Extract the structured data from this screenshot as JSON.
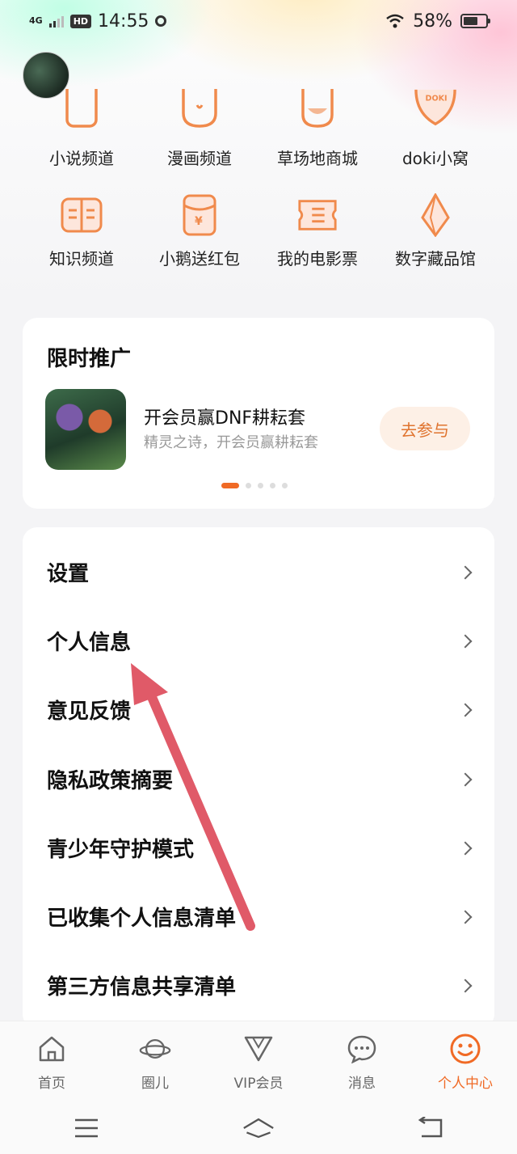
{
  "status": {
    "network": "4G",
    "hd": "HD",
    "time": "14:55",
    "battery": "58%"
  },
  "shortcuts": {
    "row1": [
      {
        "label": "小说频道",
        "icon": "book-icon"
      },
      {
        "label": "漫画频道",
        "icon": "comic-icon"
      },
      {
        "label": "草场地商城",
        "icon": "shop-icon"
      },
      {
        "label": "doki小窝",
        "icon": "doki-icon"
      }
    ],
    "row2": [
      {
        "label": "知识频道",
        "icon": "knowledge-icon"
      },
      {
        "label": "小鹅送红包",
        "icon": "red-packet-icon"
      },
      {
        "label": "我的电影票",
        "icon": "ticket-icon"
      },
      {
        "label": "数字藏品馆",
        "icon": "crystal-icon"
      }
    ]
  },
  "promo": {
    "title": "限时推广",
    "name": "开会员赢DNF耕耘套",
    "subtitle": "精灵之诗，开会员赢耕耘套",
    "button": "去参与",
    "pages": 5,
    "active_page": 1
  },
  "menu": [
    {
      "label": "设置"
    },
    {
      "label": "个人信息"
    },
    {
      "label": "意见反馈"
    },
    {
      "label": "隐私政策摘要"
    },
    {
      "label": "青少年守护模式"
    },
    {
      "label": "已收集个人信息清单"
    },
    {
      "label": "第三方信息共享清单"
    }
  ],
  "tabs": [
    {
      "label": "首页",
      "icon": "home-icon"
    },
    {
      "label": "圈儿",
      "icon": "planet-icon"
    },
    {
      "label": "VIP会员",
      "icon": "vip-icon"
    },
    {
      "label": "消息",
      "icon": "message-icon"
    },
    {
      "label": "个人中心",
      "icon": "smiley-icon",
      "active": true
    }
  ],
  "colors": {
    "accent": "#f06a25",
    "arrow": "#e05a68"
  }
}
